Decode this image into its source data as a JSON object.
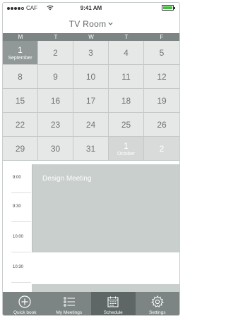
{
  "status_bar": {
    "carrier": "CAF",
    "time": "9:41 AM",
    "battery_color": "#41c23e",
    "battery_level_percent": 100
  },
  "header": {
    "title": "TV Room"
  },
  "calendar": {
    "weekdays": [
      "M",
      "T",
      "W",
      "T",
      "F"
    ],
    "days": [
      {
        "num": "1",
        "month": "September",
        "state": "selected"
      },
      {
        "num": "2",
        "month": "",
        "state": "normal"
      },
      {
        "num": "3",
        "month": "",
        "state": "normal"
      },
      {
        "num": "4",
        "month": "",
        "state": "normal"
      },
      {
        "num": "5",
        "month": "",
        "state": "normal"
      },
      {
        "num": "8",
        "month": "",
        "state": "normal"
      },
      {
        "num": "9",
        "month": "",
        "state": "normal"
      },
      {
        "num": "10",
        "month": "",
        "state": "normal"
      },
      {
        "num": "11",
        "month": "",
        "state": "normal"
      },
      {
        "num": "12",
        "month": "",
        "state": "normal"
      },
      {
        "num": "15",
        "month": "",
        "state": "normal"
      },
      {
        "num": "16",
        "month": "",
        "state": "normal"
      },
      {
        "num": "17",
        "month": "",
        "state": "normal"
      },
      {
        "num": "18",
        "month": "",
        "state": "normal"
      },
      {
        "num": "19",
        "month": "",
        "state": "normal"
      },
      {
        "num": "22",
        "month": "",
        "state": "normal"
      },
      {
        "num": "23",
        "month": "",
        "state": "normal"
      },
      {
        "num": "24",
        "month": "",
        "state": "normal"
      },
      {
        "num": "25",
        "month": "",
        "state": "normal"
      },
      {
        "num": "26",
        "month": "",
        "state": "normal"
      },
      {
        "num": "29",
        "month": "",
        "state": "normal"
      },
      {
        "num": "30",
        "month": "",
        "state": "normal"
      },
      {
        "num": "31",
        "month": "",
        "state": "normal"
      },
      {
        "num": "1",
        "month": "October",
        "state": "next"
      },
      {
        "num": "2",
        "month": "",
        "state": "next"
      }
    ]
  },
  "schedule": {
    "times": [
      "9:00",
      "9:30",
      "10:00",
      "10:30"
    ],
    "event": {
      "title": "Design Meeting"
    }
  },
  "tabbar": {
    "tabs": [
      {
        "label": "Quick book",
        "icon": "plus-circle-icon",
        "active": false
      },
      {
        "label": "My Meetings",
        "icon": "list-icon",
        "active": false
      },
      {
        "label": "Schedule",
        "icon": "calendar-icon",
        "active": true
      },
      {
        "label": "Settings",
        "icon": "gear-icon",
        "active": false
      }
    ]
  }
}
